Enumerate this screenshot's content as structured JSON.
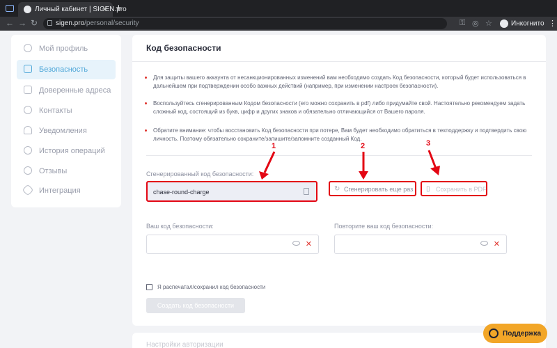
{
  "browser": {
    "tab_title": "Личный кабинет | SIGEN.pro",
    "url_host": "sigen.pro",
    "url_path": "/personal/security",
    "profile_label": "Инкогнито"
  },
  "sidebar": {
    "items": [
      {
        "label": "Мой профиль",
        "icon": "user-icon"
      },
      {
        "label": "Безопасность",
        "icon": "lock-icon"
      },
      {
        "label": "Доверенные адреса",
        "icon": "book-icon"
      },
      {
        "label": "Контакты",
        "icon": "phone-icon"
      },
      {
        "label": "Уведомления",
        "icon": "bell-icon"
      },
      {
        "label": "История операций",
        "icon": "history-icon"
      },
      {
        "label": "Отзывы",
        "icon": "chat-icon"
      },
      {
        "label": "Интеграция",
        "icon": "link-icon"
      }
    ],
    "active_index": 1
  },
  "main": {
    "title": "Код безопасности",
    "notes": [
      "Для защиты вашего аккаунта от несанкционированных изменений вам необходимо создать Код безопасности, который будет использоваться в дальнейшем при подтверждении особо важных действий (например, при изменении настроек безопасности).",
      "Воспользуйтесь сгенерированным Кодом безопасности (его можно сохранить в pdf) либо придумайте свой. Настоятельно рекомендуем задать сложный код, состоящий из букв, цифр и других знаков и обязательно отличающийся от Вашего пароля.",
      "Обратите внимание: чтобы восстановить Код безопасности при потере, Вам будет необходимо обратиться в техподдержку и подтвердить свою личность. Поэтому обязательно сохраните/запишите/запомните созданный Код."
    ],
    "generated_label": "Сгенерированный код безопасности:",
    "generated_value": "chase-round-charge",
    "regenerate_label": "Сгенерировать еще раз",
    "save_pdf_label": "Сохранить в PDF",
    "your_code_label": "Ваш код безопасности:",
    "repeat_code_label": "Повторите ваш код безопасности:",
    "checkbox_label": "Я распечатал/сохранил код безопасности",
    "create_label": "Создать код безопасности",
    "next_section_title": "Настройки авторизации"
  },
  "annotations": [
    "1",
    "2",
    "3"
  ],
  "support_label": "Поддержка",
  "colors": {
    "accent": "#4fa7d8",
    "highlight": "#e30613",
    "support": "#f2a628"
  }
}
